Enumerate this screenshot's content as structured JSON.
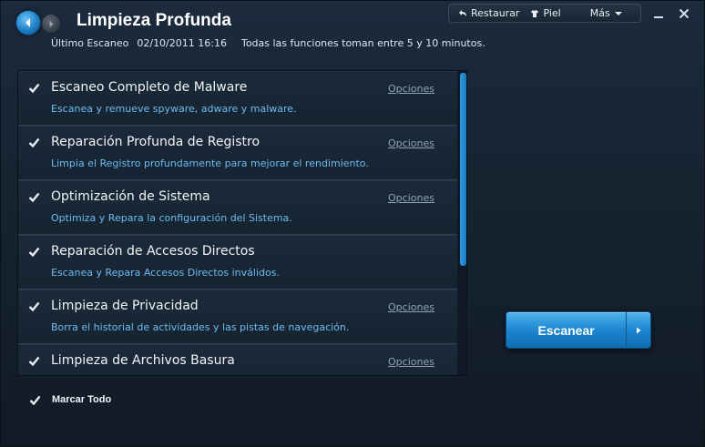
{
  "header": {
    "title": "Limpieza Profunda",
    "last_scan_label": "Último Escaneo",
    "last_scan_date": "02/10/2011 16:16",
    "info_text": "Todas las funciones toman entre 5 y 10 minutos."
  },
  "toolbar": {
    "restore_label": "Restaurar",
    "skin_label": "Piel",
    "more_label": "Más"
  },
  "list": {
    "items": [
      {
        "name": "Escaneo Completo de Malware",
        "desc": "Escanea y remueve spyware, adware y malware.",
        "options": "Opciones",
        "checked": true
      },
      {
        "name": "Reparación Profunda de Registro",
        "desc": "Limpia el Registro profundamente para mejorar el rendimiento.",
        "options": "Opciones",
        "checked": true
      },
      {
        "name": "Optimización de Sistema",
        "desc": "Optimiza y Repara la configuración del Sistema.",
        "options": "Opciones",
        "checked": true
      },
      {
        "name": "Reparación de Accesos Directos",
        "desc": "Escanea y Repara Accesos Directos inválidos.",
        "options": "",
        "checked": true
      },
      {
        "name": "Limpieza de Privacidad",
        "desc": "Borra el historial de actividades y las pistas de navegación.",
        "options": "Opciones",
        "checked": true
      },
      {
        "name": "Limpieza de Archivos Basura",
        "desc": "",
        "options": "Opciones",
        "checked": true
      }
    ]
  },
  "scan_button": {
    "label": "Escanear"
  },
  "footer": {
    "check_all_label": "Marcar Todo"
  },
  "colors": {
    "accent": "#1d86d0",
    "description_text": "#6cbcf0",
    "options_link": "#8da4ba"
  }
}
